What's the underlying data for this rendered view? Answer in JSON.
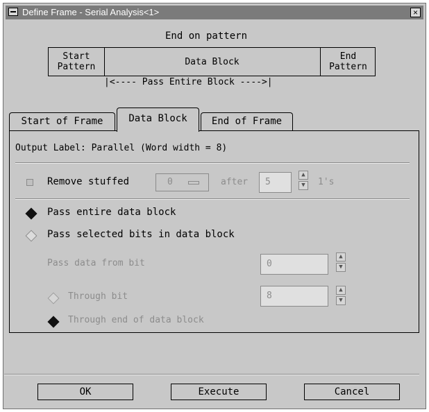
{
  "window": {
    "title": "Define Frame - Serial Analysis<1>",
    "close_glyph": "×"
  },
  "mode_text": "End on pattern",
  "diagram": {
    "start": "Start Pattern",
    "data": "Data Block",
    "end": "End Pattern",
    "pass_entire": "|<---- Pass Entire Block ---->|"
  },
  "tabs": [
    {
      "label": "Start of Frame"
    },
    {
      "label": "Data Block"
    },
    {
      "label": "End of Frame"
    }
  ],
  "panel": {
    "output_label": "Output Label: Parallel (Word width = 8)",
    "remove_stuffed": {
      "label": "Remove stuffed",
      "bit_value": "0",
      "after_label": "after",
      "count_value": "5",
      "unit_label": "1's"
    },
    "radio_entire": "Pass entire data block",
    "radio_selected": "Pass selected bits in data block",
    "from_bit": {
      "label": "Pass data from bit",
      "value": "0"
    },
    "through_bit": {
      "label": "Through bit",
      "value": "8"
    },
    "through_end": {
      "label": "Through end of data block"
    }
  },
  "buttons": {
    "ok": "OK",
    "execute": "Execute",
    "cancel": "Cancel"
  },
  "icons": {
    "spin_up": "▲",
    "spin_down": "▼"
  },
  "colors": {
    "title_bar": "#7b7b7b",
    "window_bg": "#c8c8c8",
    "disabled_text": "#8c8c8c"
  }
}
